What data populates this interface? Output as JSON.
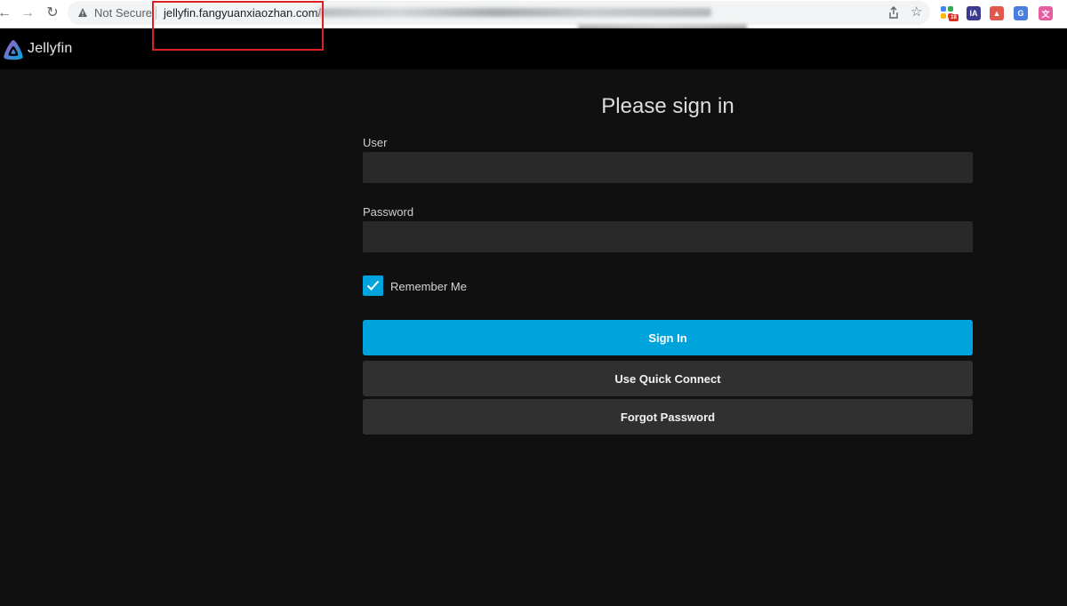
{
  "browser": {
    "back_icon": "back-arrow-icon",
    "forward_icon": "forward-arrow-icon",
    "reload_icon": "reload-icon",
    "security_label": "Not Secure",
    "url_visible": "jellyfin.fangyuanxiaozhan.com/",
    "extensions": [
      "apps-grid-icon",
      "ia-extension-icon",
      "image-extension-icon",
      "translate-extension-icon",
      "language-extension-icon"
    ],
    "extension_ia_label": "IA",
    "extension_badge": "18",
    "highlight_color": "#e02020"
  },
  "app": {
    "name": "Jellyfin",
    "accent_color": "#00a4dc"
  },
  "login": {
    "title": "Please sign in",
    "user_label": "User",
    "user_value": "",
    "password_label": "Password",
    "password_value": "",
    "remember_me_label": "Remember Me",
    "remember_me_checked": true,
    "sign_in_label": "Sign In",
    "quick_connect_label": "Use Quick Connect",
    "forgot_password_label": "Forgot Password"
  }
}
